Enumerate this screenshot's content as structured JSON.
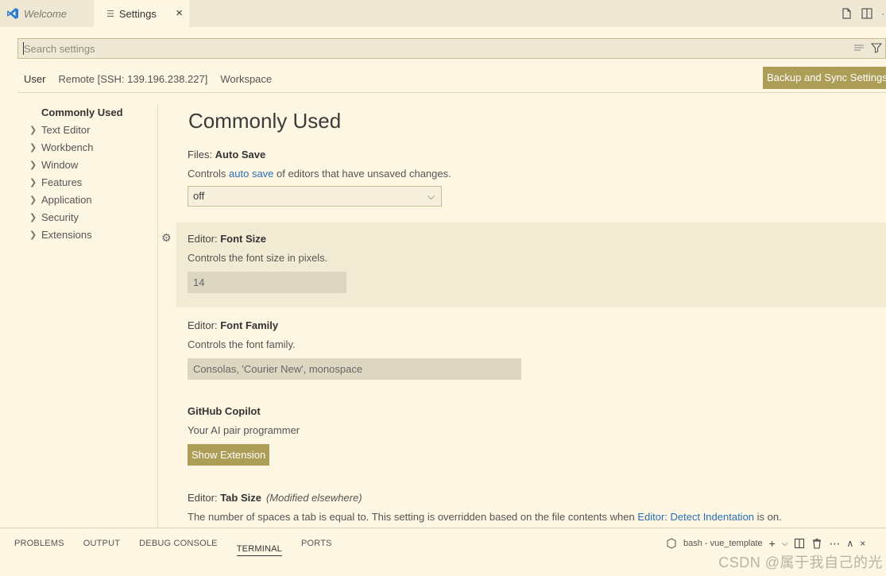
{
  "tabs": {
    "welcome": "Welcome",
    "settings": "Settings",
    "close": "×"
  },
  "search": {
    "placeholder": "Search settings"
  },
  "scope": {
    "user": "User",
    "remote": "Remote [SSH: 139.196.238.227]",
    "workspace": "Workspace",
    "sync_button": "Backup and Sync Settings"
  },
  "toc": {
    "items": [
      {
        "label": "Commonly Used",
        "active": true
      },
      {
        "label": "Text Editor"
      },
      {
        "label": "Workbench"
      },
      {
        "label": "Window"
      },
      {
        "label": "Features"
      },
      {
        "label": "Application"
      },
      {
        "label": "Security"
      },
      {
        "label": "Extensions"
      }
    ]
  },
  "main": {
    "section_title": "Commonly Used",
    "auto_save": {
      "category": "Files: ",
      "name": "Auto Save",
      "desc_before": "Controls ",
      "desc_link": "auto save",
      "desc_after": " of editors that have unsaved changes.",
      "value": "off"
    },
    "font_size": {
      "category": "Editor: ",
      "name": "Font Size",
      "desc": "Controls the font size in pixels.",
      "value": "14"
    },
    "font_family": {
      "category": "Editor: ",
      "name": "Font Family",
      "desc": "Controls the font family.",
      "value": "Consolas, 'Courier New', monospace"
    },
    "copilot": {
      "name": "GitHub Copilot",
      "desc": "Your AI pair programmer",
      "button": "Show Extension"
    },
    "tab_size": {
      "category": "Editor: ",
      "name": "Tab Size",
      "modified": "(Modified elsewhere)",
      "desc_before": "The number of spaces a tab is equal to. This setting is overridden based on the file contents when ",
      "desc_link": "Editor: Detect Indentation",
      "desc_after": " is on."
    }
  },
  "panel": {
    "tabs": [
      "PROBLEMS",
      "OUTPUT",
      "DEBUG CONSOLE",
      "TERMINAL",
      "PORTS"
    ],
    "active_tab": "TERMINAL",
    "terminal_name": "bash - vue_template"
  },
  "watermark": "CSDN @属于我自己的光",
  "colors": {
    "background": "#fdf6e3",
    "tab_bar": "#eee8d5",
    "button": "#ac9d57",
    "link": "#2a6fb8"
  }
}
